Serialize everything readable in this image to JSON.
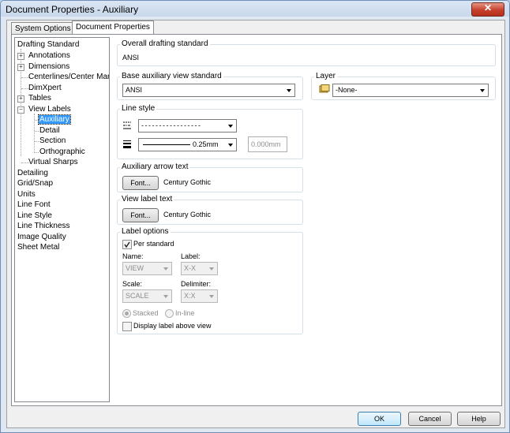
{
  "window": {
    "title": "Document Properties - Auxiliary",
    "close_glyph": "✕"
  },
  "tabs": [
    {
      "label": "System Options"
    },
    {
      "label": "Document Properties"
    }
  ],
  "tree": {
    "items": [
      {
        "label": "Drafting Standard"
      },
      {
        "label": "Annotations",
        "expander": "+"
      },
      {
        "label": "Dimensions",
        "expander": "+"
      },
      {
        "label": "Centerlines/Center Marks"
      },
      {
        "label": "DimXpert"
      },
      {
        "label": "Tables",
        "expander": "+"
      },
      {
        "label": "View Labels",
        "expander": "−"
      },
      {
        "label": "Auxiliary",
        "selected": true
      },
      {
        "label": "Detail"
      },
      {
        "label": "Section"
      },
      {
        "label": "Orthographic"
      },
      {
        "label": "Virtual Sharps"
      },
      {
        "label": "Detailing"
      },
      {
        "label": "Grid/Snap"
      },
      {
        "label": "Units"
      },
      {
        "label": "Line Font"
      },
      {
        "label": "Line Style"
      },
      {
        "label": "Line Thickness"
      },
      {
        "label": "Image Quality"
      },
      {
        "label": "Sheet Metal"
      }
    ]
  },
  "overall": {
    "label": "Overall drafting standard",
    "value": "ANSI"
  },
  "base": {
    "label": "Base auxiliary view standard",
    "value": "ANSI"
  },
  "layer": {
    "label": "Layer",
    "value": "-None-",
    "icon": "layers-icon"
  },
  "line_style": {
    "label": "Line style",
    "style_value": "- - - - - - - - - - - - - - - - -",
    "thickness_value": "0.25mm",
    "custom_thickness": "0.000mm",
    "style_icon": "line-style-icon",
    "thickness_icon": "line-thickness-icon"
  },
  "arrow_text": {
    "label": "Auxiliary arrow text",
    "button": "Font...",
    "font": "Century Gothic"
  },
  "view_label_text": {
    "label": "View label text",
    "button": "Font...",
    "font": "Century Gothic"
  },
  "label_options": {
    "label": "Label options",
    "per_standard": "Per standard",
    "per_standard_checked": true,
    "name_label": "Name:",
    "name_value": "VIEW",
    "label_label": "Label:",
    "label_value": "X-X",
    "scale_label": "Scale:",
    "scale_value": "SCALE",
    "delimiter_label": "Delimiter:",
    "delimiter_value": "X:X",
    "stacked": "Stacked",
    "inline": "In-line",
    "selected_layout": "Stacked",
    "display_above": "Display label above view",
    "display_above_checked": false
  },
  "buttons": {
    "ok": "OK",
    "cancel": "Cancel",
    "help": "Help"
  }
}
